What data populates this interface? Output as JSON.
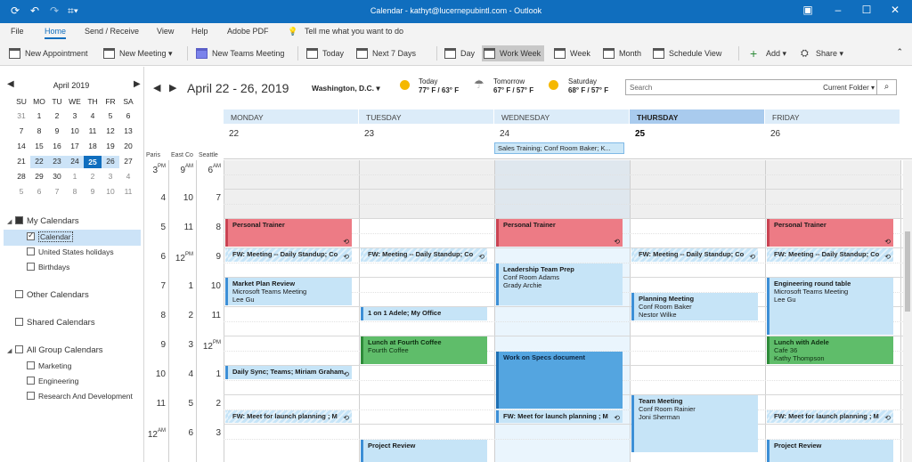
{
  "window": {
    "title": "Calendar - kathyt@lucernepubintl.com - Outlook"
  },
  "menu": [
    "File",
    "Home",
    "Send / Receive",
    "View",
    "Help",
    "Adobe PDF"
  ],
  "menu_selected": "Home",
  "tell_me": "Tell me what you want to do",
  "ribbon": {
    "new_appointment": "New Appointment",
    "new_meeting": "New Meeting",
    "new_teams_meeting": "New Teams Meeting",
    "today": "Today",
    "next7": "Next 7 Days",
    "day": "Day",
    "work_week": "Work Week",
    "week": "Week",
    "month": "Month",
    "schedule_view": "Schedule View",
    "add": "Add",
    "share": "Share"
  },
  "mini_calendar": {
    "title": "April 2019",
    "weekdays": [
      "SU",
      "MO",
      "TU",
      "WE",
      "TH",
      "FR",
      "SA"
    ],
    "weeks": [
      [
        "31",
        "1",
        "2",
        "3",
        "4",
        "5",
        "6"
      ],
      [
        "7",
        "8",
        "9",
        "10",
        "11",
        "12",
        "13"
      ],
      [
        "14",
        "15",
        "16",
        "17",
        "18",
        "19",
        "20"
      ],
      [
        "21",
        "22",
        "23",
        "24",
        "25",
        "26",
        "27"
      ],
      [
        "28",
        "29",
        "30",
        "1",
        "2",
        "3",
        "4"
      ],
      [
        "5",
        "6",
        "7",
        "8",
        "9",
        "10",
        "11"
      ]
    ],
    "today": "25"
  },
  "folders": {
    "my_calendars": "My Calendars",
    "calendar": "Calendar",
    "us_holidays": "United States holidays",
    "birthdays": "Birthdays",
    "other": "Other Calendars",
    "shared": "Shared Calendars",
    "all_group": "All Group Calendars",
    "marketing": "Marketing",
    "engineering": "Engineering",
    "rnd": "Research And Development"
  },
  "header": {
    "range": "April 22 - 26, 2019",
    "location": "Washington, D.C.",
    "weather": [
      {
        "day": "Today",
        "temp": "77° F / 63° F"
      },
      {
        "day": "Tomorrow",
        "temp": "67° F / 57° F"
      },
      {
        "day": "Saturday",
        "temp": "68° F / 57° F"
      }
    ],
    "search_placeholder": "Search",
    "search_scope": "Current Folder"
  },
  "days": [
    {
      "name": "MONDAY",
      "num": "22"
    },
    {
      "name": "TUESDAY",
      "num": "23"
    },
    {
      "name": "WEDNESDAY",
      "num": "24"
    },
    {
      "name": "THURSDAY",
      "num": "25"
    },
    {
      "name": "FRIDAY",
      "num": "26"
    }
  ],
  "timezones": [
    "Paris",
    "East Co",
    "Seattle"
  ],
  "hours": [
    [
      "3",
      "PM",
      "9",
      "AM",
      "6",
      "AM"
    ],
    [
      "4",
      "",
      "10",
      "",
      "7",
      ""
    ],
    [
      "5",
      "",
      "11",
      "",
      "8",
      ""
    ],
    [
      "6",
      "",
      "12",
      "PM",
      "9",
      ""
    ],
    [
      "7",
      "",
      "1",
      "",
      "10",
      ""
    ],
    [
      "8",
      "",
      "2",
      "",
      "11",
      ""
    ],
    [
      "9",
      "",
      "3",
      "",
      "12",
      "PM"
    ],
    [
      "10",
      "",
      "4",
      "",
      "1",
      ""
    ],
    [
      "11",
      "",
      "5",
      "",
      "2",
      ""
    ],
    [
      "12",
      "AM",
      "6",
      "",
      "3",
      ""
    ]
  ],
  "allday_event": "Sales Training; Conf Room Baker; K...",
  "events": [
    {
      "day": 0,
      "start": 2,
      "dur": 1,
      "color": "red",
      "title": "Personal Trainer",
      "lines": [],
      "rec": true
    },
    {
      "day": 2,
      "start": 2,
      "dur": 1,
      "color": "red",
      "title": "Personal Trainer",
      "lines": [],
      "rec": true
    },
    {
      "day": 4,
      "start": 2,
      "dur": 1,
      "color": "red",
      "title": "Personal Trainer",
      "lines": [],
      "rec": true
    },
    {
      "day": 0,
      "start": 3,
      "dur": 0.5,
      "color": "hatch",
      "title": "FW: Meeting -- Daily Standup; Co",
      "lines": [],
      "rec": true
    },
    {
      "day": 1,
      "start": 3,
      "dur": 0.5,
      "color": "hatch",
      "title": "FW: Meeting -- Daily Standup; Co",
      "lines": [],
      "rec": true
    },
    {
      "day": 3,
      "start": 3,
      "dur": 0.5,
      "color": "hatch",
      "title": "FW: Meeting -- Daily Standup; Co",
      "lines": [],
      "rec": true
    },
    {
      "day": 4,
      "start": 3,
      "dur": 0.5,
      "color": "hatch",
      "title": "FW: Meeting -- Daily Standup; Co",
      "lines": [],
      "rec": true
    },
    {
      "day": 2,
      "start": 3.5,
      "dur": 1.5,
      "color": "blue",
      "title": "Leadership Team Prep",
      "lines": [
        "Conf Room Adams",
        "Grady Archie"
      ],
      "rec": false
    },
    {
      "day": 0,
      "start": 4,
      "dur": 1,
      "color": "blue",
      "title": "Market Plan Review",
      "lines": [
        "Microsoft Teams Meeting",
        "Lee Gu"
      ],
      "rec": false
    },
    {
      "day": 4,
      "start": 4,
      "dur": 2,
      "color": "blue",
      "title": "Engineering round table",
      "lines": [
        "Microsoft Teams Meeting",
        "Lee Gu"
      ],
      "rec": false
    },
    {
      "day": 3,
      "start": 4.5,
      "dur": 1,
      "color": "blue",
      "title": "Planning Meeting",
      "lines": [
        "Conf Room Baker",
        "Nestor Wilke"
      ],
      "rec": false
    },
    {
      "day": 1,
      "start": 5,
      "dur": 0.5,
      "color": "blue",
      "title": "1 on 1 Adele; My Office",
      "lines": [],
      "rec": false
    },
    {
      "day": 1,
      "start": 6,
      "dur": 1,
      "color": "green",
      "title": "Lunch at Fourth Coffee",
      "lines": [
        "Fourth Coffee"
      ],
      "rec": false
    },
    {
      "day": 4,
      "start": 6,
      "dur": 1,
      "color": "green",
      "title": "Lunch with Adele",
      "lines": [
        "Cafe 36",
        "Kathy Thompson"
      ],
      "rec": false
    },
    {
      "day": 2,
      "start": 6.5,
      "dur": 2,
      "color": "dblue",
      "title": "Work on Specs document",
      "lines": [],
      "rec": false
    },
    {
      "day": 0,
      "start": 7,
      "dur": 0.5,
      "color": "blue",
      "title": "Daily Sync; Teams; Miriam Graham",
      "lines": [],
      "rec": true
    },
    {
      "day": 3,
      "start": 8,
      "dur": 2,
      "color": "blue",
      "title": "Team Meeting",
      "lines": [
        "Conf Room Rainier",
        "Joni Sherman"
      ],
      "rec": false
    },
    {
      "day": 0,
      "start": 8.5,
      "dur": 0.5,
      "color": "hatch",
      "title": "FW: Meet for launch planning ; M",
      "lines": [],
      "rec": true
    },
    {
      "day": 2,
      "start": 8.5,
      "dur": 0.5,
      "color": "blue",
      "title": "FW: Meet for launch planning ; M",
      "lines": [],
      "rec": true
    },
    {
      "day": 4,
      "start": 8.5,
      "dur": 0.5,
      "color": "hatch",
      "title": "FW: Meet for launch planning ; M",
      "lines": [],
      "rec": true
    },
    {
      "day": 1,
      "start": 9.5,
      "dur": 1,
      "color": "blue",
      "title": "Project Review",
      "lines": [],
      "rec": false
    },
    {
      "day": 4,
      "start": 9.5,
      "dur": 1,
      "color": "blue",
      "title": "Project Review",
      "lines": [],
      "rec": false
    }
  ]
}
